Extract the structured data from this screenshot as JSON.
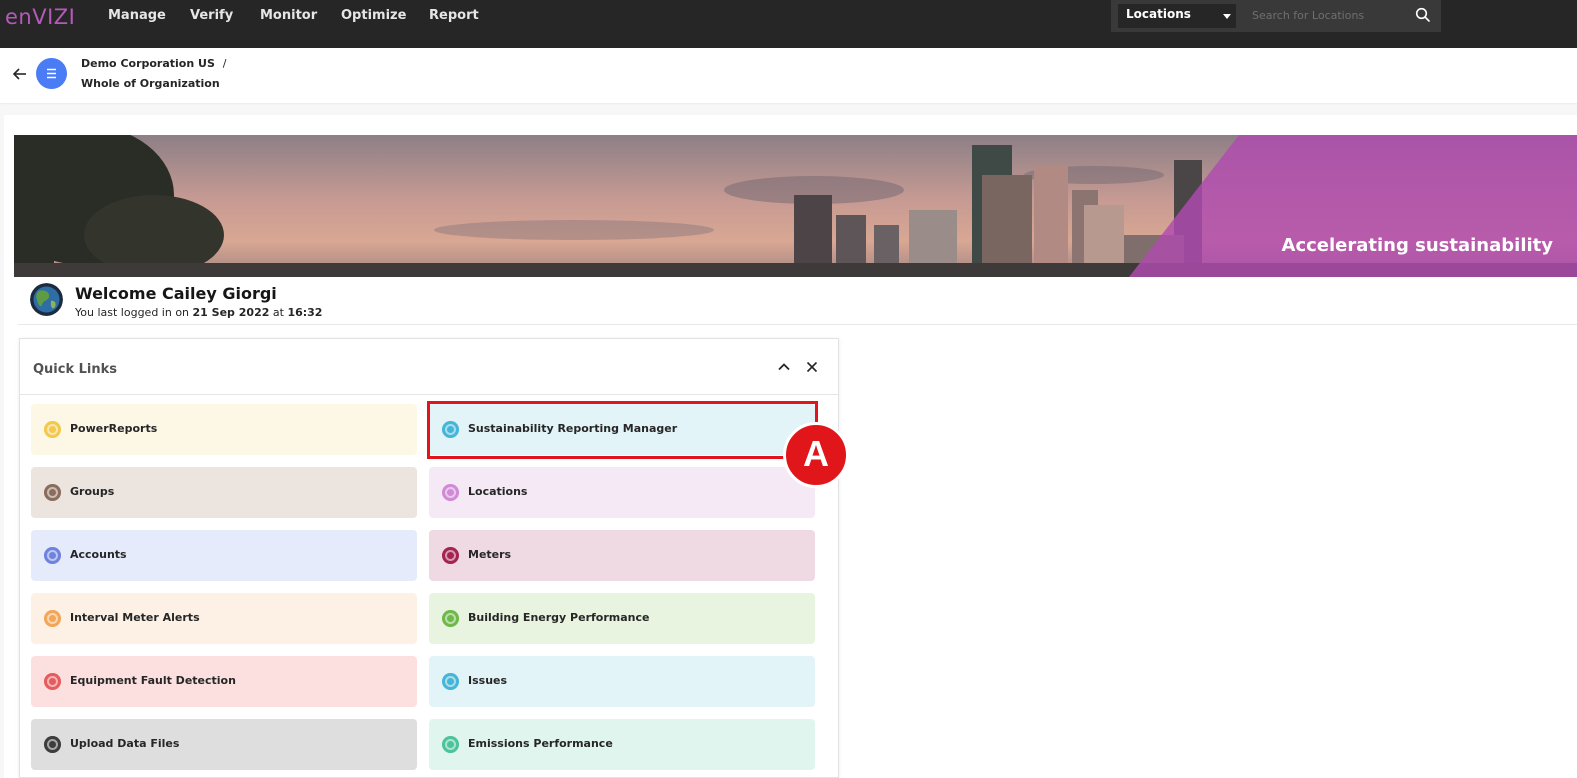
{
  "app": {
    "logo": "enVIZI",
    "logo_color": "#b45ab8"
  },
  "nav": {
    "items": [
      "Manage",
      "Verify",
      "Monitor",
      "Optimize",
      "Report"
    ]
  },
  "location_search": {
    "selected": "Locations",
    "placeholder": "Search for Locations"
  },
  "breadcrumb": {
    "organization": "Demo Corporation US",
    "separator": "/",
    "scope": "Whole of Organization"
  },
  "banner": {
    "tagline": "Accelerating sustainability"
  },
  "welcome": {
    "greeting": "Welcome Cailey Giorgi",
    "last_login_prefix": "You last logged in on",
    "last_login_date": "21 Sep 2022",
    "last_login_at": "at",
    "last_login_time": "16:32"
  },
  "quick_links": {
    "title": "Quick Links",
    "tiles": [
      {
        "label": "PowerReports",
        "icon": "report-icon",
        "bg": "#fdf7e6",
        "icon_color": "#f2c94c"
      },
      {
        "label": "Sustainability Reporting Manager",
        "icon": "monitor-icon",
        "bg": "#e3f4f9",
        "icon_color": "#45b5d8"
      },
      {
        "label": "Groups",
        "icon": "groups-icon",
        "bg": "#ebe4df",
        "icon_color": "#8a6d5c"
      },
      {
        "label": "Locations",
        "icon": "location-pin-icon",
        "bg": "#f6e9f6",
        "icon_color": "#d08ad6"
      },
      {
        "label": "Accounts",
        "icon": "accounts-icon",
        "bg": "#e6ebfb",
        "icon_color": "#6e83e0"
      },
      {
        "label": "Meters",
        "icon": "meter-icon",
        "bg": "#efd9e2",
        "icon_color": "#a5234f"
      },
      {
        "label": "Interval Meter Alerts",
        "icon": "bell-icon",
        "bg": "#fdf1e6",
        "icon_color": "#f2a65a"
      },
      {
        "label": "Building Energy Performance",
        "icon": "building-energy-icon",
        "bg": "#e8f4df",
        "icon_color": "#6fb84a"
      },
      {
        "label": "Equipment Fault Detection",
        "icon": "fault-signal-icon",
        "bg": "#fce0e0",
        "icon_color": "#e65c5c"
      },
      {
        "label": "Issues",
        "icon": "issues-icon",
        "bg": "#e3f4f9",
        "icon_color": "#45b5d8"
      },
      {
        "label": "Upload Data Files",
        "icon": "upload-icon",
        "bg": "#dedede",
        "icon_color": "#3d3d3d"
      },
      {
        "label": "Emissions Performance",
        "icon": "emissions-icon",
        "bg": "#e1f5ef",
        "icon_color": "#4cc39a"
      }
    ]
  },
  "annotation": {
    "marker_label": "A",
    "color": "#e0161a"
  }
}
